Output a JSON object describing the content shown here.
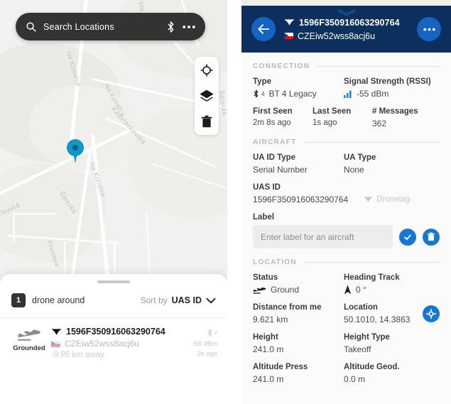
{
  "map": {
    "search": {
      "placeholder": "Search Locations",
      "icon": "search-icon",
      "bluetooth_icon": "bluetooth-icon",
      "more_icon": "more-horizontal-icon"
    },
    "controls": [
      {
        "name": "locate-me-button",
        "icon": "crosshair-icon"
      },
      {
        "name": "map-layers-button",
        "icon": "layers-icon"
      },
      {
        "name": "clear-map-button",
        "icon": "trash-icon"
      }
    ],
    "pin": {
      "name": "drone-map-pin",
      "color": "#1295c9"
    },
    "street_labels": [
      "Na Kotlářce",
      "Na Kotlářce",
      "Na Kotlářce",
      "Kadeřávkovská",
      "Šárecká",
      "zlovská",
      "Preslova",
      "Stá",
      "Šárecká"
    ]
  },
  "sheet": {
    "count": "1",
    "around_label": "drone around",
    "sort_by_label": "Sort by",
    "sort_value": "UAS ID",
    "chevron_icon": "chevron-down-icon",
    "drone": {
      "state": "Grounded",
      "state_icon": "plane-landing-icon",
      "id": "1596F350916063290764",
      "id_icon": "drone-icon",
      "operator": "CZEiw52wss8acj6u",
      "flag": "cz-flag-icon",
      "distance": "-9.96 km away",
      "bt_icon": "bluetooth-icon",
      "bt_version": "4",
      "rssi": "-58 dBm",
      "last_seen": "3s ago"
    }
  },
  "detail": {
    "header": {
      "back_icon": "arrow-left-icon",
      "more_icon": "more-horizontal-icon",
      "id": "1596F350916063290764",
      "id_icon": "drone-icon",
      "operator": "CZEiw52wss8acj6u",
      "flag": "cz-flag-icon",
      "handle_icon": "chevron-down-icon",
      "bg_color": "#0d2f5e",
      "accent_color": "#1565c0"
    },
    "sections": {
      "connection": {
        "title": "CONNECTION",
        "type_label": "Type",
        "type_value": "BT 4 Legacy",
        "type_icon": "bluetooth-icon",
        "type_sup": "4",
        "rssi_label": "Signal Strength (RSSI)",
        "rssi_value": "-55 dBm",
        "rssi_icon": "signal-bars-icon",
        "first_seen_label": "First Seen",
        "first_seen_value": "2m 8s ago",
        "last_seen_label": "Last Seen",
        "last_seen_value": "1s ago",
        "messages_label": "# Messages",
        "messages_value": "362"
      },
      "aircraft": {
        "title": "AIRCRAFT",
        "ua_id_type_label": "UA ID Type",
        "ua_id_type_value": "Serial Number",
        "ua_type_label": "UA Type",
        "ua_type_value": "None",
        "uas_id_label": "UAS ID",
        "uas_id_value": "1596F350916063290764",
        "dronetag_label": "Dronetag",
        "dronetag_icon": "drone-icon",
        "label_label": "Label",
        "label_value": "",
        "label_placeholder": "Enter label for an aircraft",
        "confirm_icon": "check-circle-icon",
        "delete_icon": "trash-icon"
      },
      "location": {
        "title": "LOCATION",
        "status_label": "Status",
        "status_value": "Ground",
        "status_icon": "plane-landing-icon",
        "heading_label": "Heading Track",
        "heading_value": "0 °",
        "heading_icon": "navigation-arrow-icon",
        "distance_label": "Distance from me",
        "distance_value": "9.621 km",
        "location_label": "Location",
        "location_value": "50.1010, 14.3863",
        "locate_icon": "target-icon",
        "height_label": "Height",
        "height_value": "241.0 m",
        "height_type_label": "Height Type",
        "height_type_value": "Takeoff",
        "alt_press_label": "Altitude Press",
        "alt_press_value": "241.0 m",
        "alt_geod_label": "Altitude Geod.",
        "alt_geod_value": "0.0 m"
      }
    }
  }
}
